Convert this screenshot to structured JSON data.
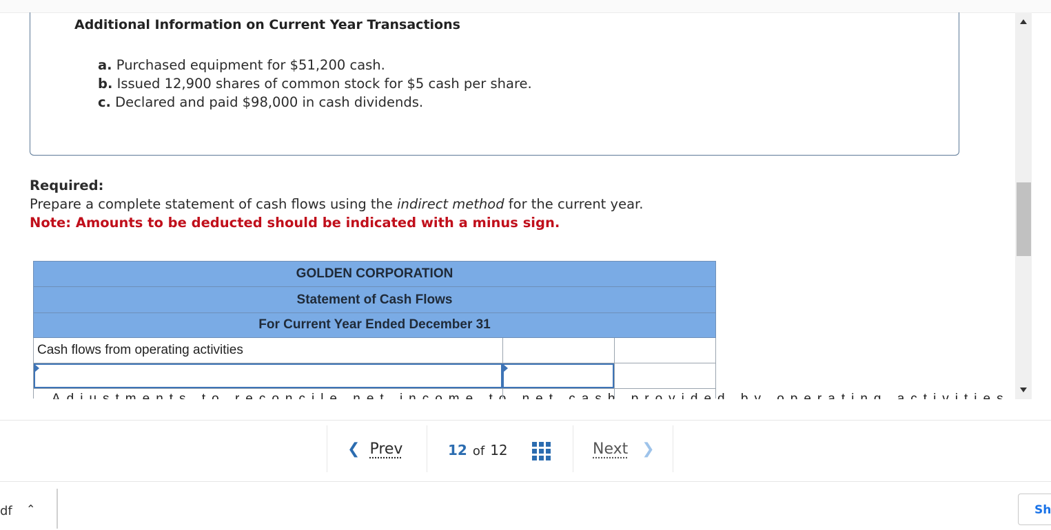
{
  "additional_info": {
    "title": "Additional Information on Current Year Transactions",
    "items": [
      {
        "letter": "a.",
        "text": "Purchased equipment for $51,200 cash."
      },
      {
        "letter": "b.",
        "text": "Issued 12,900 shares of common stock for $5 cash per share."
      },
      {
        "letter": "c.",
        "text": "Declared and paid $98,000 in cash dividends."
      }
    ]
  },
  "required": {
    "label": "Required:",
    "text_before": "Prepare a complete statement of cash flows using the ",
    "text_italic": "indirect method",
    "text_after": " for the current year.",
    "note": "Note: Amounts to be deducted should be indicated with a minus sign."
  },
  "statement": {
    "company": "GOLDEN CORPORATION",
    "title": "Statement of Cash Flows",
    "period": "For Current Year Ended December 31",
    "rows": [
      {
        "label": "Cash flows from operating activities"
      }
    ],
    "cut_off_row": "Adjustments to reconcile net income to net cash provided by operating activities"
  },
  "pager": {
    "prev": "Prev",
    "current": "12",
    "of": "of",
    "total": "12",
    "next": "Next"
  },
  "download_bar": {
    "file_label": "df",
    "show_all": "Sh"
  },
  "colors": {
    "header_blue": "#7aabe5",
    "note_red": "#c00f1b",
    "link_blue": "#2b6cb0"
  }
}
